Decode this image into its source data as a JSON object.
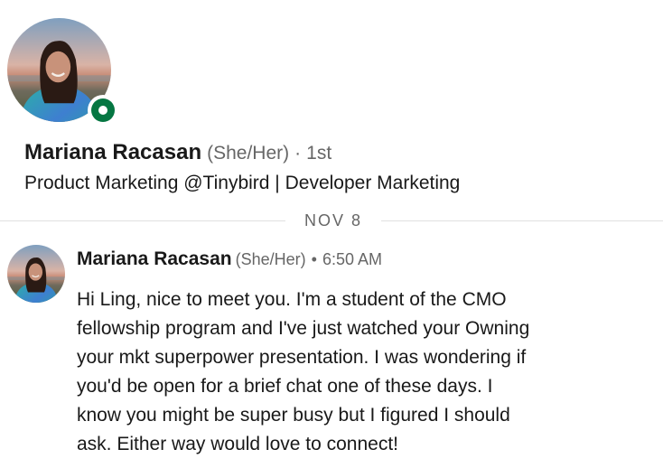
{
  "profile": {
    "name": "Mariana Racasan",
    "pronouns": "(She/Her)",
    "separator": "·",
    "degree": "1st",
    "headline": "Product Marketing @Tinybird | Developer Marketing",
    "online": true,
    "presence_color": "#057642"
  },
  "date_divider": {
    "label": "NOV 8"
  },
  "message": {
    "sender": "Mariana Racasan",
    "pronouns": "(She/Her)",
    "separator": "•",
    "time": "6:50 AM",
    "body_lines": [
      "Hi Ling, nice to meet you. I'm a student of the CMO",
      "fellowship program and I've just watched your Owning",
      "your mkt superpower presentation. I was wondering if",
      "you'd be open for a brief chat one of these days. I",
      "know you might be super busy but I figured I should",
      "ask. Either way would love to connect!"
    ]
  }
}
